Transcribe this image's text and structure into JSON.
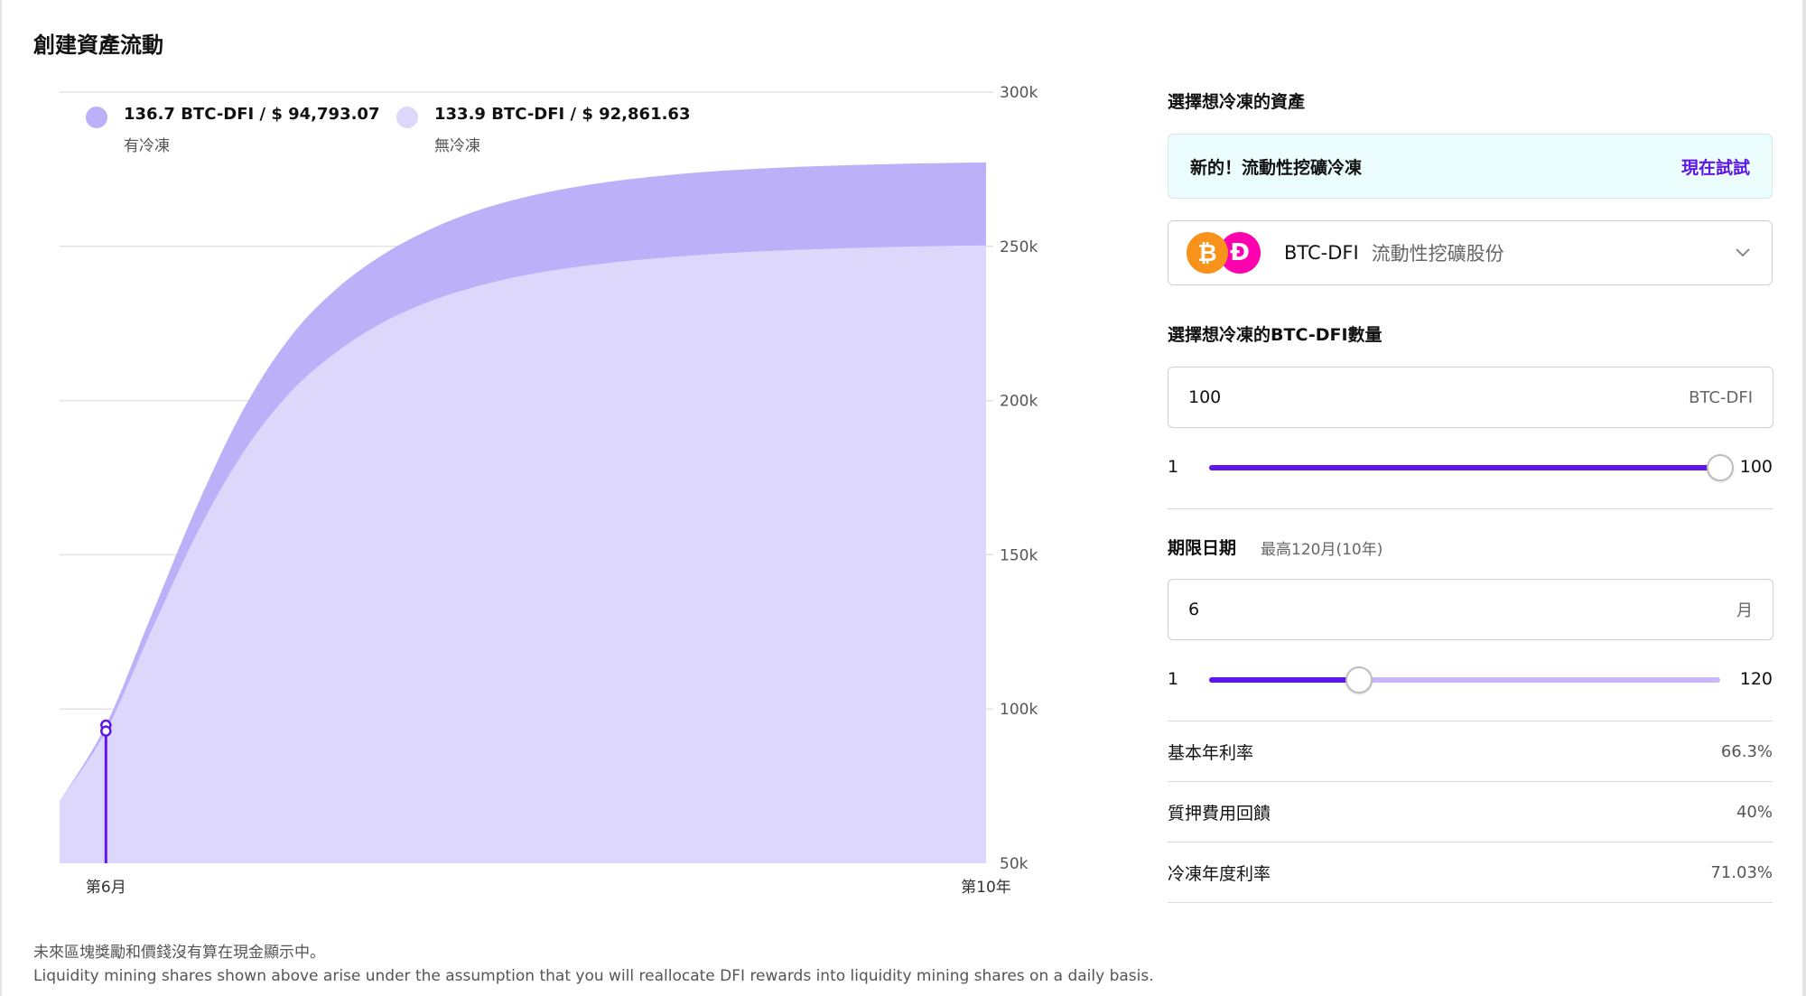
{
  "page": {
    "title": "創建資產流動"
  },
  "legend": [
    {
      "value": "136.7 BTC-DFI / $ 94,793.07",
      "label": "有冷凍",
      "color": "#bcb1f9"
    },
    {
      "value": "133.9 BTC-DFI / $ 92,861.63",
      "label": "無冷凍",
      "color": "#ddd7fc"
    }
  ],
  "chart_data": {
    "type": "area",
    "title": "",
    "xlabel": "",
    "ylabel": "",
    "x_tick_labels": [
      "第6月",
      "第10年"
    ],
    "x_months": [
      0,
      6,
      12,
      18,
      24,
      30,
      36,
      42,
      48,
      54,
      60,
      66,
      72,
      78,
      84,
      90,
      96,
      102,
      108,
      114,
      120
    ],
    "y_tick_labels": [
      "300k",
      "250k",
      "200k",
      "150k",
      "100k",
      "50k"
    ],
    "y_ticks": [
      300000,
      250000,
      200000,
      150000,
      100000,
      50000
    ],
    "ylim": [
      50000,
      300000
    ],
    "xlim": [
      0,
      120
    ],
    "grid": true,
    "legend_position": "top-left",
    "series": [
      {
        "name": "有冷凍",
        "color": "#bcb1f9",
        "values": [
          70000,
          94793,
          131000,
          167000,
          198000,
          221000,
          236500,
          247500,
          255500,
          261500,
          265800,
          268900,
          271200,
          272900,
          274200,
          275100,
          275800,
          276300,
          276700,
          277000,
          277200
        ]
      },
      {
        "name": "無冷凍",
        "color": "#ddd7fc",
        "values": [
          70000,
          92862,
          126000,
          158000,
          184000,
          203000,
          216000,
          225500,
          232200,
          237000,
          240500,
          243000,
          244900,
          246300,
          247400,
          248300,
          248900,
          249400,
          249800,
          250100,
          250300
        ]
      }
    ],
    "marker": {
      "x": 6,
      "values": [
        94793,
        92862
      ],
      "color": "#5e17eb"
    }
  },
  "footer": {
    "note_zh": "未來區塊獎勵和價錢沒有算在現金顯示中。",
    "note_en": "Liquidity mining shares shown above arise under the assumption that you will reallocate DFI rewards into liquidity mining shares on a daily basis."
  },
  "form": {
    "asset_label": "選擇想冷凍的資產",
    "promo_text": "新的！流動性挖礦冷凍",
    "promo_link": "現在試試",
    "asset_pair": "BTC-DFI",
    "asset_desc": "流動性挖礦股份",
    "amount_label": "選擇想冷凍的BTC-DFI數量",
    "amount_value": "100",
    "amount_unit": "BTC-DFI",
    "amount_slider": {
      "min": "1",
      "max": "100",
      "value": 100,
      "min_num": 1,
      "max_num": 100
    },
    "term_label": "期限日期",
    "term_hint": "最高120月(10年)",
    "term_value": "6",
    "term_unit": "月",
    "term_slider": {
      "min": "1",
      "max": "120",
      "value": 36,
      "min_num": 1,
      "max_num": 120
    },
    "stats": [
      {
        "label": "基本年利率",
        "value": "66.3%"
      },
      {
        "label": "質押費用回饋",
        "value": "40%"
      },
      {
        "label": "冷凍年度利率",
        "value": "71.03%"
      }
    ],
    "accent_color": "#5e17eb"
  }
}
